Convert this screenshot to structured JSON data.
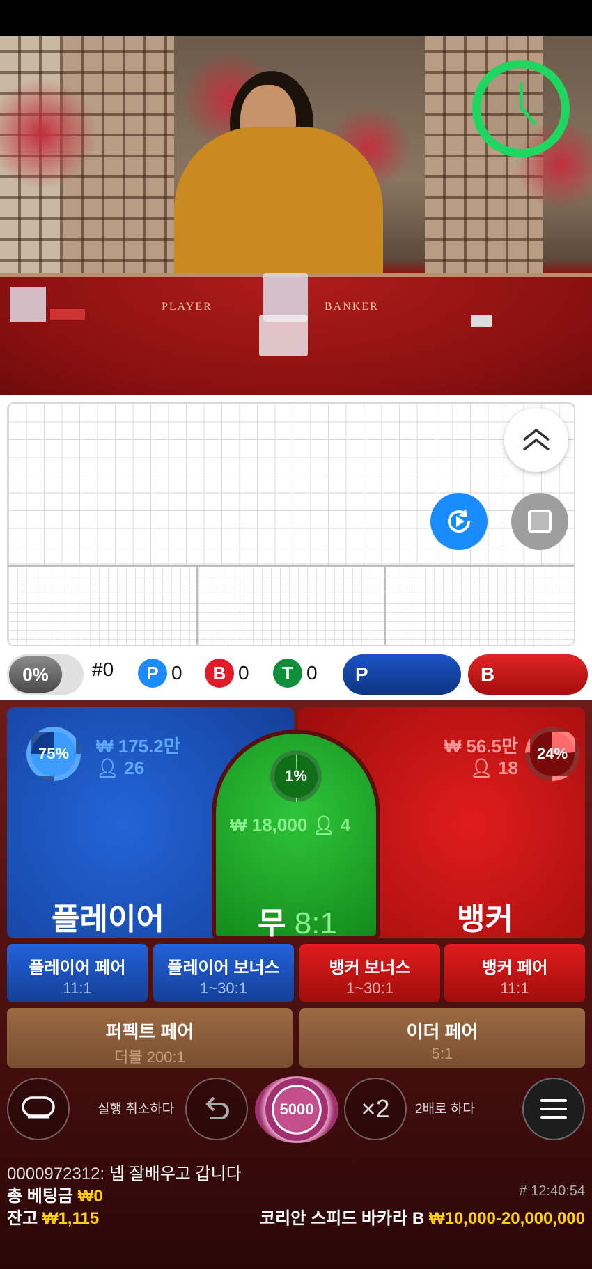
{
  "road_stats": {
    "win_pct": "0%",
    "round_count": "#0",
    "player_letter": "P",
    "player_count": "0",
    "banker_letter": "B",
    "banker_count": "0",
    "tie_letter": "T",
    "tie_count": "0",
    "predict_player": "P",
    "predict_banker": "B"
  },
  "video": {
    "table_label_player": "PLAYER",
    "table_label_banker": "BANKER"
  },
  "bets": {
    "player": {
      "pct": "75%",
      "amount": "₩ 175.2만",
      "users": "26",
      "label": "플레이어",
      "pct_value": 0.75
    },
    "tie": {
      "pct": "1%",
      "amount": "₩ 18,000",
      "users": "4",
      "label": "무",
      "odds": "8:1",
      "pct_value": 0.01
    },
    "banker": {
      "pct": "24%",
      "amount": "₩ 56.5만",
      "users": "18",
      "label": "뱅커",
      "pct_value": 0.24
    }
  },
  "side_bets": [
    {
      "label": "플레이어 페어",
      "odds": "11:1"
    },
    {
      "label": "플레이어 보너스",
      "odds": "1~30:1"
    },
    {
      "label": "뱅커 보너스",
      "odds": "1~30:1"
    },
    {
      "label": "뱅커 페어",
      "odds": "11:1"
    }
  ],
  "gold_bets": [
    {
      "label": "퍼펙트 페어",
      "odds": "더블 200:1"
    },
    {
      "label": "이더 페어",
      "odds": "5:1"
    }
  ],
  "controls": {
    "undo_label": "실행 취소하다",
    "chip_value": "5000",
    "double_symbol": "×2",
    "double_label": "2배로 하다"
  },
  "chat": {
    "user": "0000972312:",
    "message": " 넵 잘배우고 갑니다"
  },
  "footer": {
    "total_bet_label": "총 베팅금",
    "total_bet_value": "₩0",
    "balance_label": "잔고",
    "balance_value": "₩1,115",
    "timestamp": "# 12:40:54",
    "table_name": "코리안 스피드 바카라 B",
    "limits": "₩10,000-20,000,000"
  },
  "colors": {
    "player_blue": "#1a5fd6",
    "banker_red": "#d41515",
    "tie_green": "#1ea82a",
    "accent_yellow": "#ffd000",
    "timer_green": "#1ed760"
  }
}
